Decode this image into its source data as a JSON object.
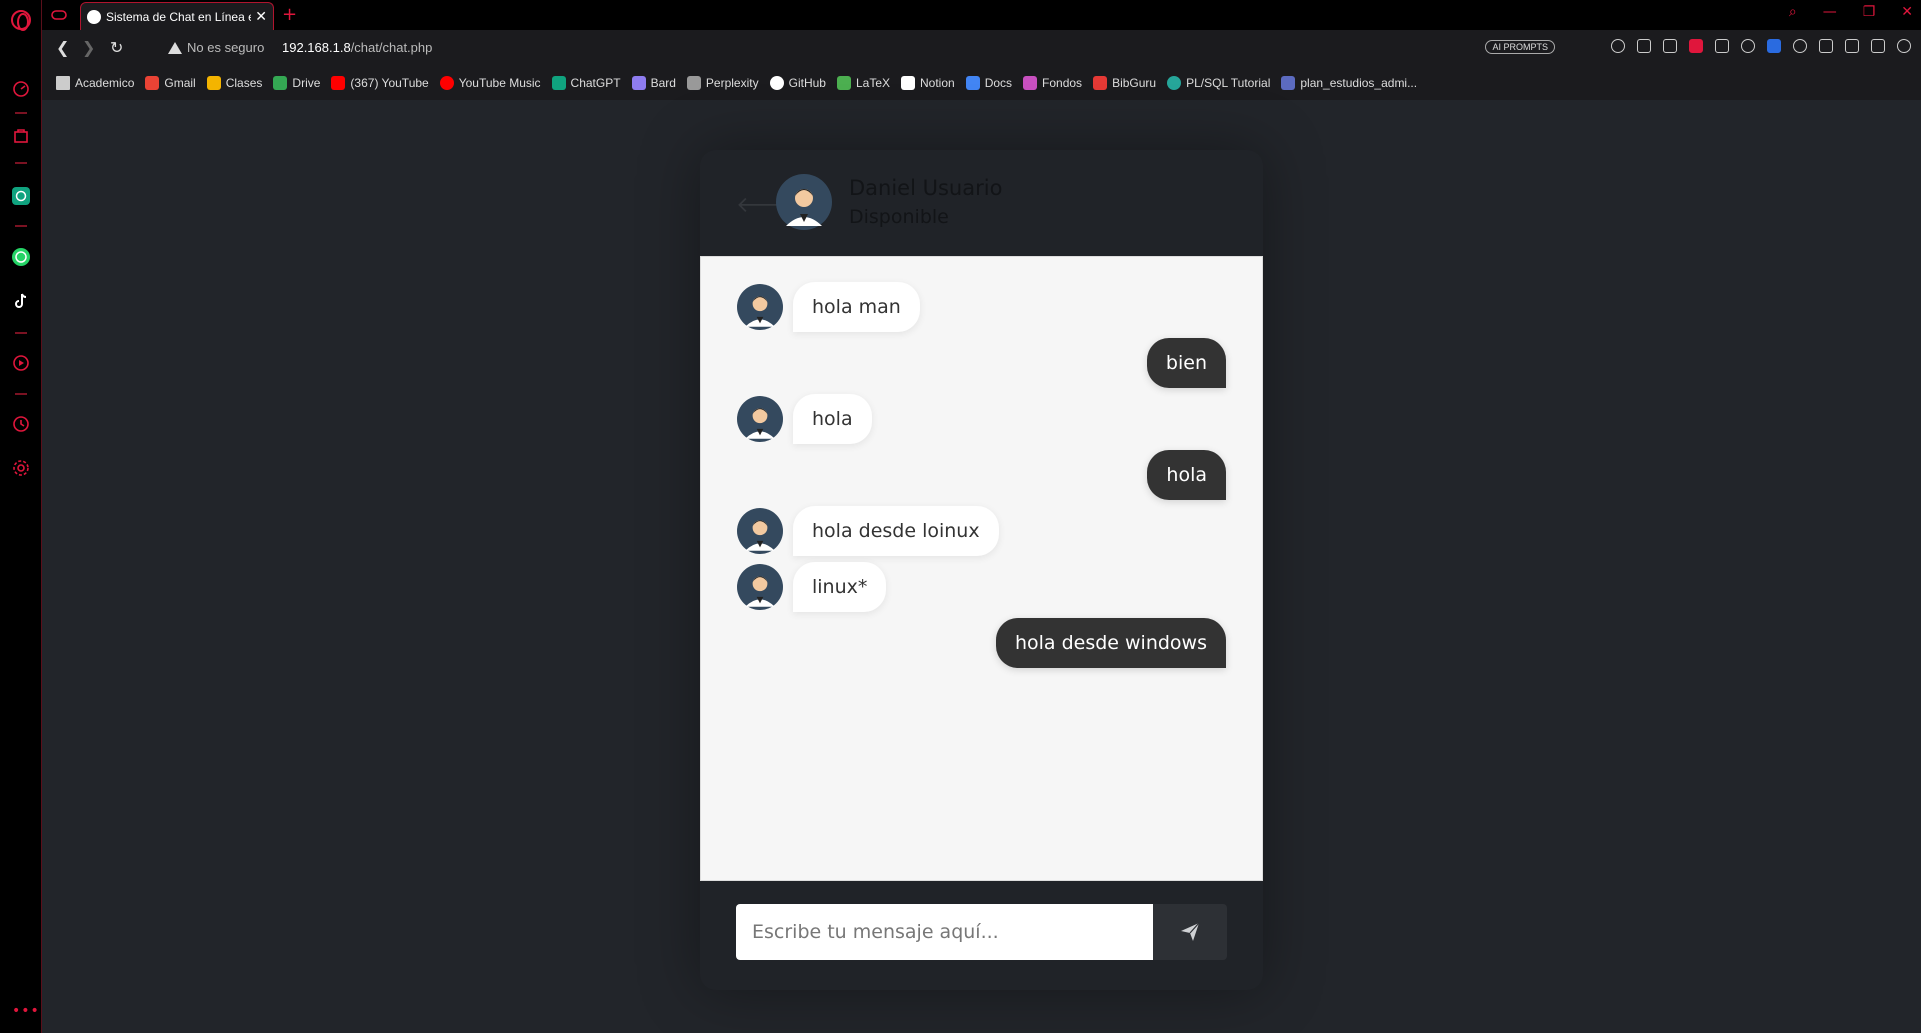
{
  "browser": {
    "tab_title": "Sistema de Chat en Línea e",
    "security_label": "No es seguro",
    "url_host": "192.168.1.8",
    "url_path": "/chat/chat.php",
    "ai_prompts_label": "AI PROMPTS",
    "accent_color": "#e0163c",
    "bookmarks": [
      {
        "label": "Academico",
        "icon": "star-icon"
      },
      {
        "label": "Gmail",
        "icon": "gmail-icon"
      },
      {
        "label": "Clases",
        "icon": "classroom-icon"
      },
      {
        "label": "Drive",
        "icon": "drive-icon"
      },
      {
        "label": "(367) YouTube",
        "icon": "youtube-icon"
      },
      {
        "label": "YouTube Music",
        "icon": "youtube-music-icon"
      },
      {
        "label": "ChatGPT",
        "icon": "chatgpt-icon"
      },
      {
        "label": "Bard",
        "icon": "bard-icon"
      },
      {
        "label": "Perplexity",
        "icon": "perplexity-icon"
      },
      {
        "label": "GitHub",
        "icon": "github-icon"
      },
      {
        "label": "LaTeX",
        "icon": "latex-icon"
      },
      {
        "label": "Notion",
        "icon": "notion-icon"
      },
      {
        "label": "Docs",
        "icon": "docs-icon"
      },
      {
        "label": "Fondos",
        "icon": "fondos-icon"
      },
      {
        "label": "BibGuru",
        "icon": "bibguru-icon"
      },
      {
        "label": "PL/SQL Tutorial",
        "icon": "plsql-icon"
      },
      {
        "label": "plan_estudios_admi...",
        "icon": "document-icon"
      }
    ]
  },
  "chat": {
    "user_name": "Daniel Usuario",
    "user_status": "Disponible",
    "messages": [
      {
        "direction": "in",
        "text": "hola man"
      },
      {
        "direction": "out",
        "text": "bien"
      },
      {
        "direction": "in",
        "text": "hola"
      },
      {
        "direction": "out",
        "text": "hola"
      },
      {
        "direction": "in",
        "text": "hola desde loinux"
      },
      {
        "direction": "in",
        "text": "linux*"
      },
      {
        "direction": "out",
        "text": "hola desde windows"
      }
    ],
    "input_placeholder": "Escribe tu mensaje aquí...",
    "send_icon": "paper-plane-icon"
  }
}
